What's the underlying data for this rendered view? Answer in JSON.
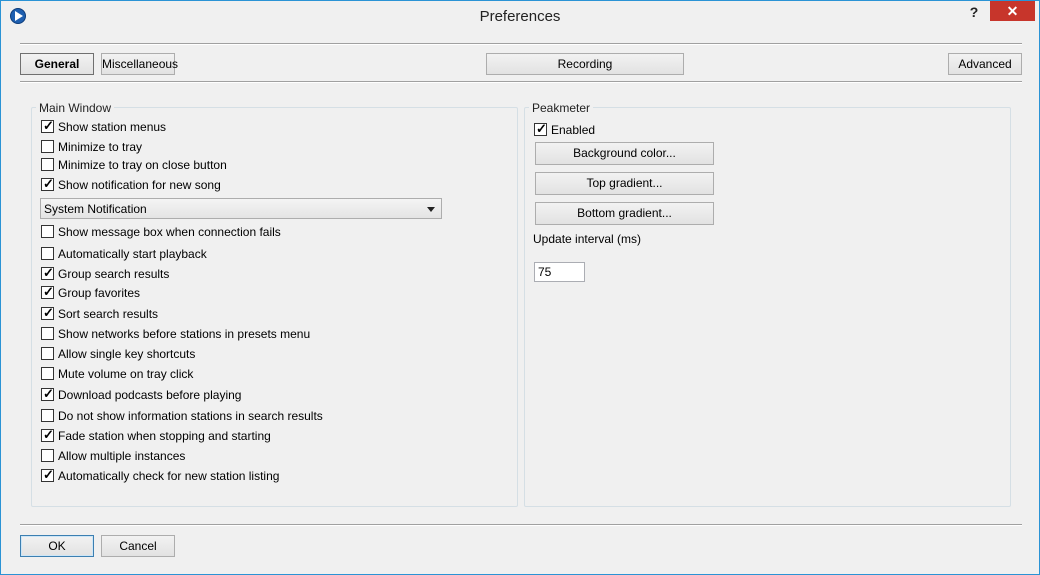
{
  "window": {
    "title": "Preferences",
    "help_label": "?",
    "close_label": "✕"
  },
  "tabs": {
    "general": "General",
    "miscellaneous": "Miscellaneous",
    "recording": "Recording",
    "advanced": "Advanced"
  },
  "main_window": {
    "title": "Main Window",
    "options": [
      {
        "label": "Show station menus",
        "checked": true
      },
      {
        "label": "Minimize to tray",
        "checked": false
      },
      {
        "label": "Minimize to tray on close button",
        "checked": false
      },
      {
        "label": "Show notification for new song",
        "checked": true
      }
    ],
    "notification_select": {
      "value": "System Notification"
    },
    "options2": [
      {
        "label": "Show message box when connection fails",
        "checked": false
      },
      {
        "label": "Automatically start playback",
        "checked": false
      },
      {
        "label": "Group search results",
        "checked": true
      },
      {
        "label": "Group favorites",
        "checked": true
      },
      {
        "label": "Sort search results",
        "checked": true
      },
      {
        "label": "Show networks before stations in presets menu",
        "checked": false
      },
      {
        "label": "Allow single key shortcuts",
        "checked": false
      },
      {
        "label": "Mute volume on tray click",
        "checked": false
      },
      {
        "label": "Download podcasts before playing",
        "checked": true
      },
      {
        "label": "Do not show information stations in search results",
        "checked": false
      },
      {
        "label": "Fade station when stopping and starting",
        "checked": true
      },
      {
        "label": "Allow multiple instances",
        "checked": false
      },
      {
        "label": "Automatically check for new station listing",
        "checked": true
      }
    ]
  },
  "peakmeter": {
    "title": "Peakmeter",
    "enabled": {
      "label": "Enabled",
      "checked": true
    },
    "background_color_label": "Background color...",
    "top_gradient_label": "Top gradient...",
    "bottom_gradient_label": "Bottom gradient...",
    "update_interval_label": "Update interval (ms)",
    "update_interval_value": "75"
  },
  "footer": {
    "ok_label": "OK",
    "cancel_label": "Cancel"
  }
}
